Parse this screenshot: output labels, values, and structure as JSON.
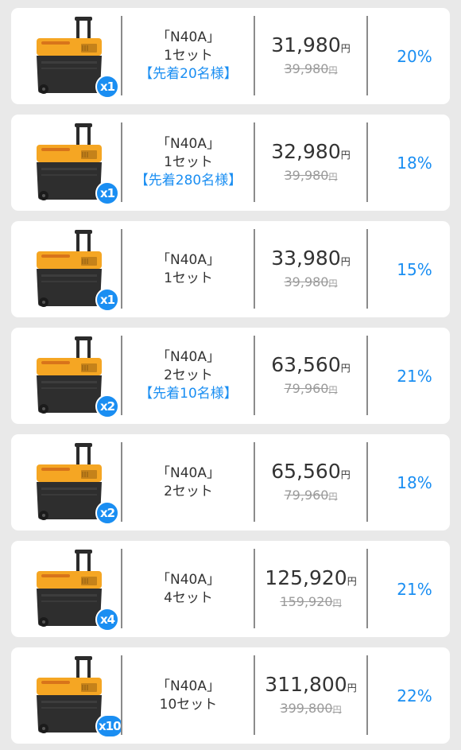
{
  "offers": [
    {
      "qty_badge": "x1",
      "model": "「N40A」",
      "sets": "1セット",
      "promo": "【先着20名様】",
      "price": "31,980",
      "currency": "円",
      "original_price": "39,980",
      "discount": "20%"
    },
    {
      "qty_badge": "x1",
      "model": "「N40A」",
      "sets": "1セット",
      "promo": "【先着280名様】",
      "price": "32,980",
      "currency": "円",
      "original_price": "39,980",
      "discount": "18%"
    },
    {
      "qty_badge": "x1",
      "model": "「N40A」",
      "sets": "1セット",
      "promo": "",
      "price": "33,980",
      "currency": "円",
      "original_price": "39,980",
      "discount": "15%"
    },
    {
      "qty_badge": "x2",
      "model": "「N40A」",
      "sets": "2セット",
      "promo": "【先着10名様】",
      "price": "63,560",
      "currency": "円",
      "original_price": "79,960",
      "discount": "21%"
    },
    {
      "qty_badge": "x2",
      "model": "「N40A」",
      "sets": "2セット",
      "promo": "",
      "price": "65,560",
      "currency": "円",
      "original_price": "79,960",
      "discount": "18%"
    },
    {
      "qty_badge": "x4",
      "model": "「N40A」",
      "sets": "4セット",
      "promo": "",
      "price": "125,920",
      "currency": "円",
      "original_price": "159,920",
      "discount": "21%"
    },
    {
      "qty_badge": "x10",
      "model": "「N40A」",
      "sets": "10セット",
      "promo": "",
      "price": "311,800",
      "currency": "円",
      "original_price": "399,800",
      "discount": "22%"
    }
  ],
  "colors": {
    "accent_blue": "#1a8ef2",
    "cooler_orange": "#f5a623",
    "cooler_body": "#2e2e2e",
    "card_bg": "#ffffff",
    "page_bg": "#e9e9e9"
  },
  "icons": {
    "product_image": "portable-fridge-cooler-with-handle-image"
  }
}
